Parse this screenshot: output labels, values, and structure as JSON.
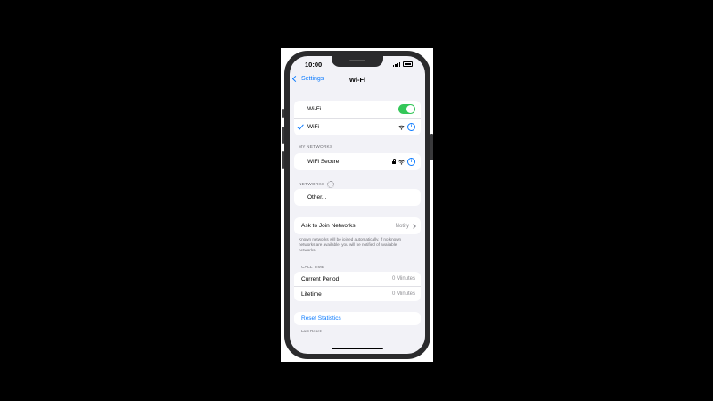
{
  "status_bar": {
    "time": "10:00"
  },
  "nav": {
    "back_label": "Settings",
    "title": "Wi-Fi"
  },
  "wifi_group": {
    "toggle_label": "Wi-Fi",
    "toggle_on": true,
    "connected_network": "WiFi"
  },
  "my_networks": {
    "header": "MY NETWORKS",
    "items": [
      {
        "name": "WiFi Secure",
        "locked": true
      }
    ]
  },
  "networks": {
    "header": "NETWORKS",
    "other_label": "Other..."
  },
  "ask_to_join": {
    "label": "Ask to Join Networks",
    "value": "Notify",
    "footnote": "Known networks will be joined automatically. If no known networks are available, you will be notified of available networks."
  },
  "call_time": {
    "header": "CALL TIME",
    "rows": [
      {
        "label": "Current Period",
        "value": "0 Minutes"
      },
      {
        "label": "Lifetime",
        "value": "0 Minutes"
      }
    ]
  },
  "reset": {
    "label": "Reset Statistics",
    "last_reset_label": "Last Reset:"
  },
  "colors": {
    "accent": "#0a7aff",
    "toggle_on": "#34c759",
    "background": "#f2f2f7"
  }
}
